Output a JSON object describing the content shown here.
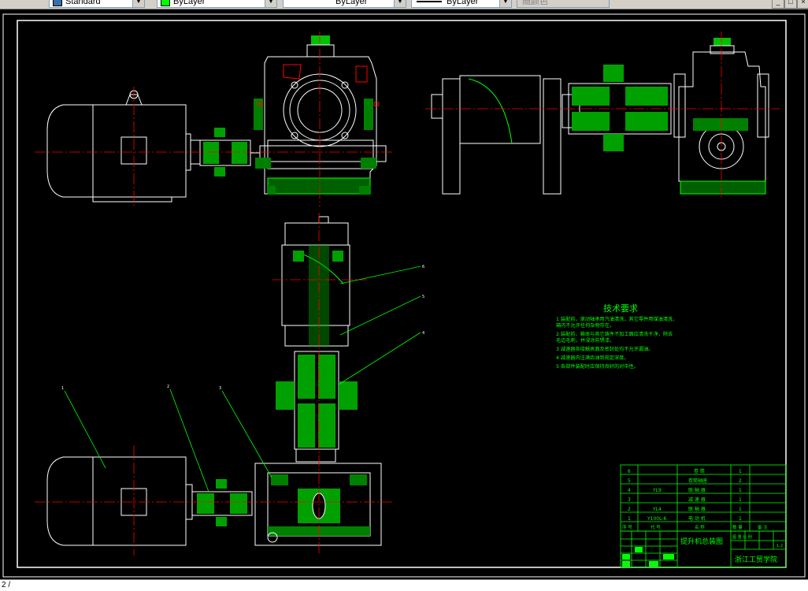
{
  "toolbar": {
    "text_style": "Standard",
    "layer_color": "ByLayer",
    "linetype": "ByLayer",
    "lineweight": "ByLayer",
    "plot_style": "随颜色"
  },
  "colors": {
    "green": "#00ff00",
    "white": "#ffffff",
    "red": "#ff0000",
    "yellow": "#ffff00",
    "cyan": "#00ffff"
  },
  "drawing": {
    "tech_title": "技术要求",
    "tech_notes": [
      "1 装配前，滚动轴承用汽油清洗，其它零件用煤油清洗，",
      "箱内不允许任何杂物存在。",
      "2 装配前，箱体与其它铸件不加工面应清洗干净，除去",
      "毛边毛刺，并浸涂防锈漆。",
      "3 减速器各接触表面及密封处均不允许漏油。",
      "4 减速器内注满齿油到规定深度。",
      "5 各部件装配时应保持良好的对中性。"
    ],
    "parts": [
      {
        "no": "6",
        "code": "",
        "name": "卷 筒",
        "qty": "1"
      },
      {
        "no": "5",
        "code": "",
        "name": "卷筒轴座",
        "qty": "2"
      },
      {
        "no": "4",
        "code": "YL9",
        "name": "联 轴 器",
        "qty": "1"
      },
      {
        "no": "3",
        "code": "",
        "name": "减 速 器",
        "qty": "1"
      },
      {
        "no": "2",
        "code": "YL4",
        "name": "联 轴 器",
        "qty": "1"
      },
      {
        "no": "1",
        "code": "Y100L-6",
        "name": "电 动 机",
        "qty": "1"
      }
    ],
    "parts_header": {
      "no": "序 号",
      "code": "代 号",
      "name": "名 称",
      "qty": "数 量",
      "note": "备 注"
    },
    "title_name": "提升机总装图",
    "school": "浙江工贸学院",
    "scale_header": "图 重 比 例",
    "scale": "1:2"
  },
  "cmd": {
    "prompt": "2 /"
  }
}
